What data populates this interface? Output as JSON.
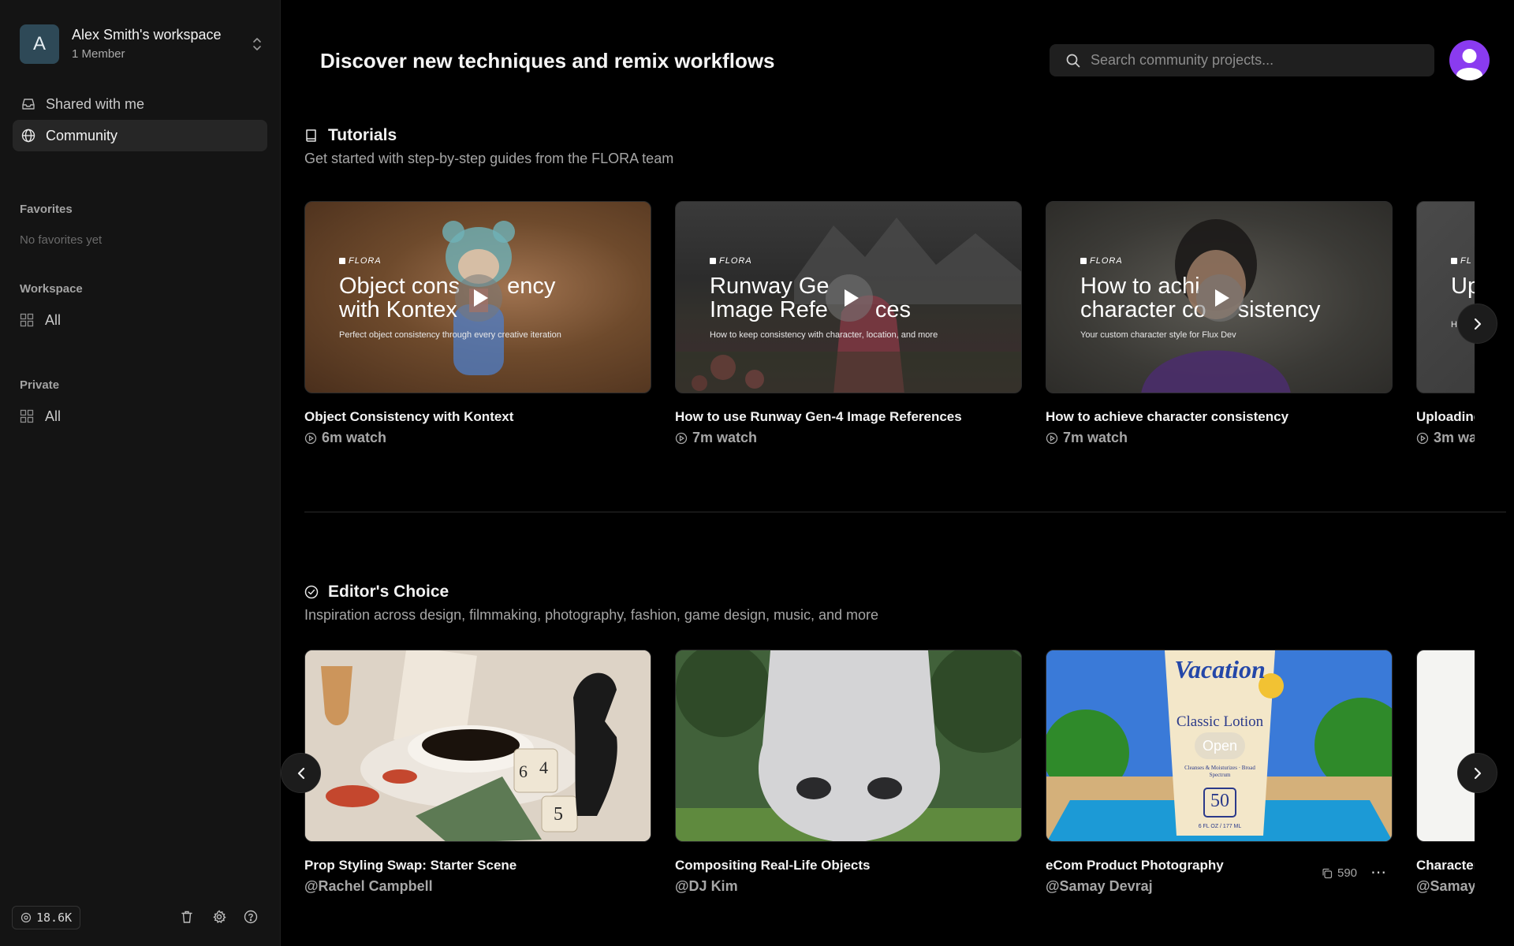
{
  "sidebar": {
    "workspace": {
      "initial": "A",
      "name": "Alex Smith's workspace",
      "members": "1 Member"
    },
    "nav": [
      {
        "label": "Shared with me",
        "icon": "inbox-icon"
      },
      {
        "label": "Community",
        "icon": "globe-icon"
      }
    ],
    "favorites": {
      "label": "Favorites",
      "empty": "No favorites yet"
    },
    "workspace_section": {
      "label": "Workspace",
      "item": "All"
    },
    "private_section": {
      "label": "Private",
      "item": "All"
    },
    "credits": "18.6K"
  },
  "header": {
    "title": "Discover new techniques and remix workflows",
    "search_placeholder": "Search community projects..."
  },
  "tutorials": {
    "title": "Tutorials",
    "subtitle": "Get started with step-by-step guides from the FLORA team",
    "cards": [
      {
        "title": "Object Consistency with Kontext",
        "meta": "6m watch",
        "brand": "FLORA",
        "heading_1": "Object cons",
        "heading_1b": "ency",
        "heading_2": "with Kontex",
        "tagline": "Perfect object consistency through every creative iteration"
      },
      {
        "title": "How to use Runway Gen-4 Image References",
        "meta": "7m watch",
        "brand": "FLORA",
        "heading_1": "Runway Ge",
        "heading_2": "Image Refe",
        "heading_2b": "ces",
        "tagline": "How to keep consistency with character, location, and more"
      },
      {
        "title": "How to achieve character consistency",
        "meta": "7m watch",
        "brand": "FLORA",
        "heading_1": "How to achi",
        "heading_2": "character co",
        "heading_2b": "sistency",
        "tagline": "Your custom character style for Flux Dev"
      },
      {
        "title": "Uploading",
        "meta": "3m wa",
        "brand": "FL",
        "heading_1": "Up",
        "tagline": "Ho"
      }
    ]
  },
  "editors_choice": {
    "title": "Editor's Choice",
    "subtitle": "Inspiration across design, filmmaking, photography, fashion, game design, music, and more",
    "cards": [
      {
        "title": "Prop Styling Swap: Starter Scene",
        "author": "@Rachel Campbell",
        "dice_1": "6",
        "dice_2": "4",
        "dice_3": "5"
      },
      {
        "title": "Compositing Real-Life Objects",
        "author": "@DJ Kim"
      },
      {
        "title": "eCom Product Photography",
        "author": "@Samay Devraj",
        "open_label": "Open",
        "remixes": "590",
        "bottle_brand": "Vacation",
        "bottle_line": "Classic Lotion",
        "bottle_spf": "50",
        "bottle_note": "6 FL OZ / 177 ML",
        "bottle_fine": "Cleanses & Moisturizes · Broad Spectrum"
      },
      {
        "title": "Character",
        "author": "@Samay"
      }
    ]
  },
  "colors": {
    "accent_avatar": "#8a3bf0",
    "workspace_avatar": "#2e4957",
    "bg": "#000000",
    "sidebar": "#141414"
  }
}
